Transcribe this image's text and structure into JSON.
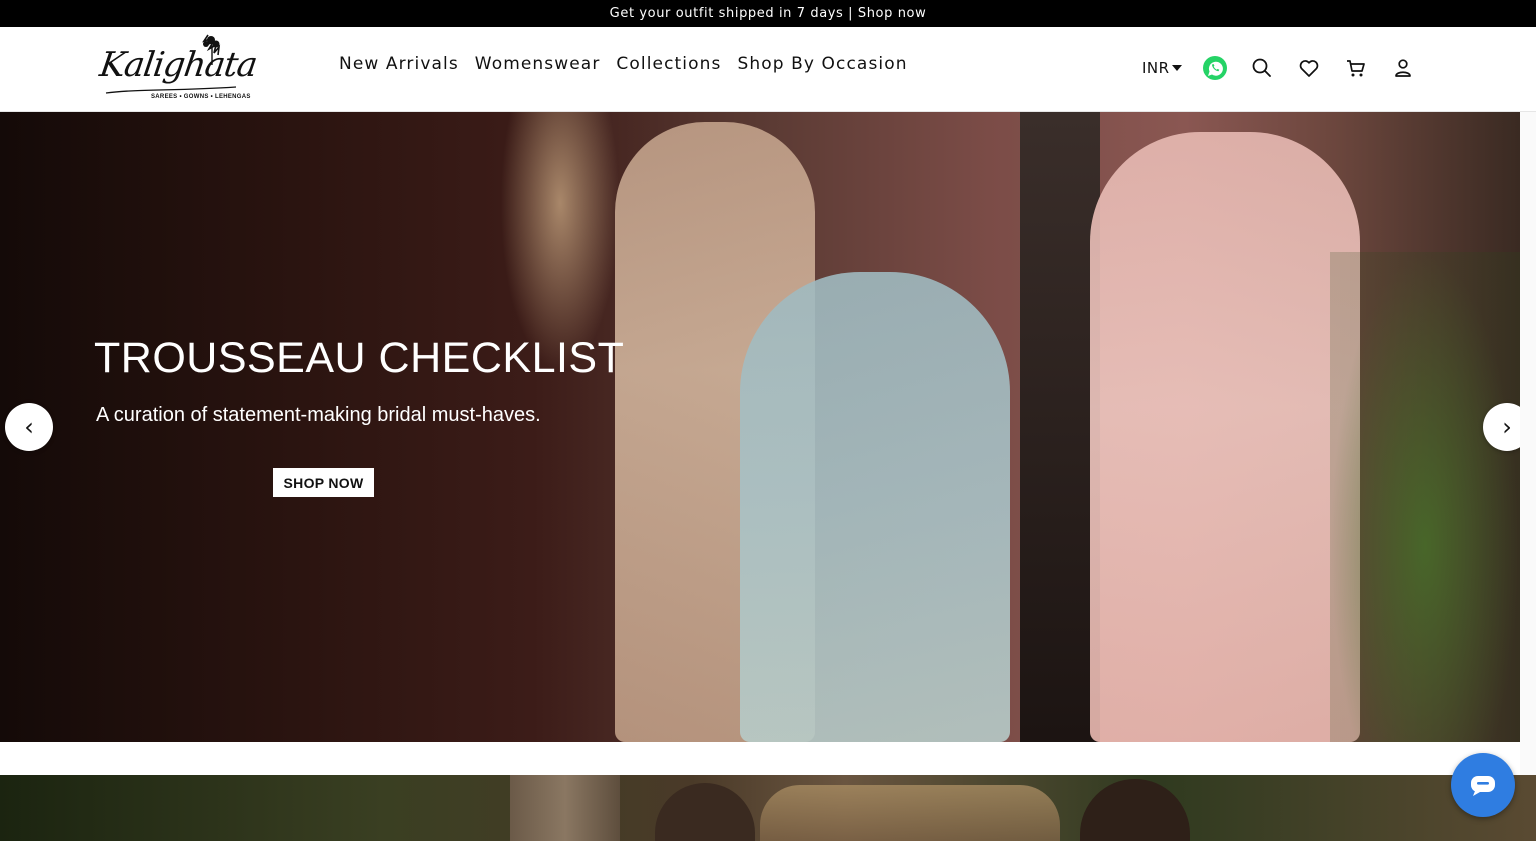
{
  "announcement": {
    "text": "Get your outfit shipped in 7 days | Shop now"
  },
  "logo": {
    "script": "Kalighata",
    "tagline": "SAREES • GOWNS • LEHENGAS"
  },
  "nav": [
    {
      "label": "New Arrivals"
    },
    {
      "label": "Womenswear"
    },
    {
      "label": "Collections"
    },
    {
      "label": "Shop By Occasion"
    }
  ],
  "tools": {
    "currency": "INR",
    "icons": [
      "whatsapp-icon",
      "search-icon",
      "heart-icon",
      "cart-icon",
      "user-icon"
    ]
  },
  "hero": {
    "title": "TROUSSEAU CHECKLIST",
    "subtitle": "A curation of statement-making bridal must-haves.",
    "cta": "SHOP NOW",
    "prev": "‹",
    "next": "›"
  },
  "colors": {
    "whatsapp": "#25d366",
    "chat": "#2f7de1",
    "announce_bg": "#000000"
  }
}
